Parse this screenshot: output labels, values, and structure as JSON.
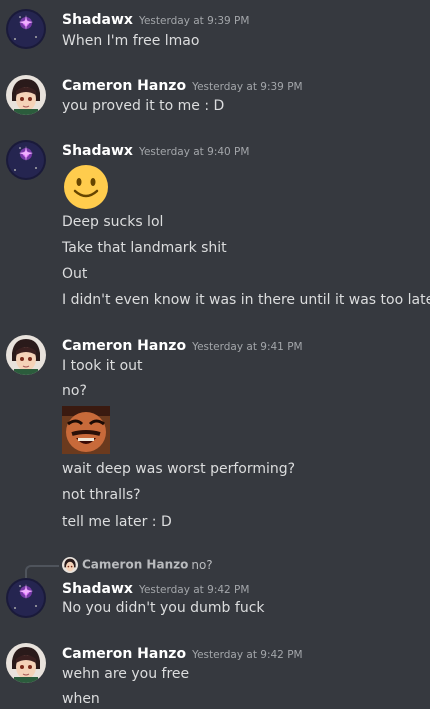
{
  "users": {
    "shadawx": "Shadawx",
    "cameron": "Cameron Hanzo"
  },
  "messages": [
    {
      "author": "Shadawx",
      "time": "Yesterday at 9:39 PM",
      "lines": [
        "When I'm free lmao"
      ]
    },
    {
      "author": "Cameron Hanzo",
      "time": "Yesterday at 9:39 PM",
      "lines": [
        "you proved it to me : D"
      ]
    },
    {
      "author": "Shadawx",
      "time": "Yesterday at 9:40 PM",
      "emoji": "slightly-smiling-face",
      "lines": [
        "Deep sucks lol",
        "Take that landmark shit",
        "Out",
        "I didn't even know it was in there until it was too late"
      ]
    },
    {
      "author": "Cameron Hanzo",
      "time": "Yesterday at 9:41 PM",
      "lines": [
        "I took it out",
        "no?",
        "wait deep was worst performing?",
        "not thralls?",
        "tell me later : D"
      ],
      "image": "laughing-man-meme"
    },
    {
      "author": "Shadawx",
      "time": "Yesterday at 9:42 PM",
      "reply": {
        "author": "Cameron Hanzo",
        "text": "no?"
      },
      "lines": [
        "No you didn't you dumb fuck"
      ]
    },
    {
      "author": "Cameron Hanzo",
      "time": "Yesterday at 9:42 PM",
      "lines": [
        "wehn are you free",
        "when"
      ]
    }
  ],
  "colors": {
    "background": "#36393f",
    "username": "#ffffff",
    "timestamp": "#a3a6aa",
    "text": "#dcddde"
  }
}
